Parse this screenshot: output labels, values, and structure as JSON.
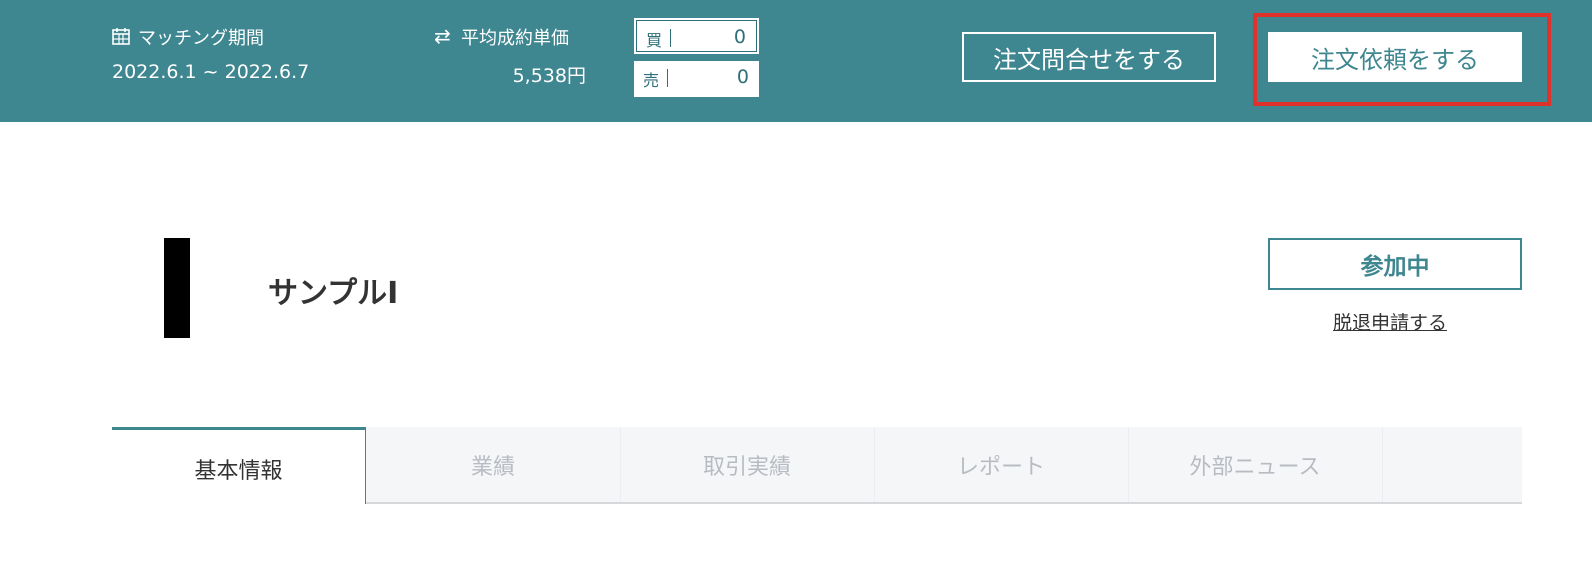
{
  "header": {
    "matching_period_label": "マッチング期間",
    "matching_period_value": "2022.6.1 ~ 2022.6.7",
    "avg_price_label": "平均成約単価",
    "avg_price_value": "5,538円",
    "buy_label": "買",
    "buy_value": "0",
    "sell_label": "売",
    "sell_value": "0",
    "inquiry_button": "注文問合せをする",
    "order_button": "注文依頼をする",
    "bg_color": "#3e8690",
    "highlight_color": "#e0322b"
  },
  "company": {
    "name": "サンプルI",
    "participating_button": "参加中",
    "withdraw_link": "脱退申請する"
  },
  "tabs": [
    {
      "label": "基本情報",
      "active": true
    },
    {
      "label": "業績",
      "active": false
    },
    {
      "label": "取引実績",
      "active": false
    },
    {
      "label": "レポート",
      "active": false
    },
    {
      "label": "外部ニュース",
      "active": false
    }
  ],
  "icons": {
    "calendar": "calendar-icon",
    "exchange": "exchange-arrows-icon"
  }
}
